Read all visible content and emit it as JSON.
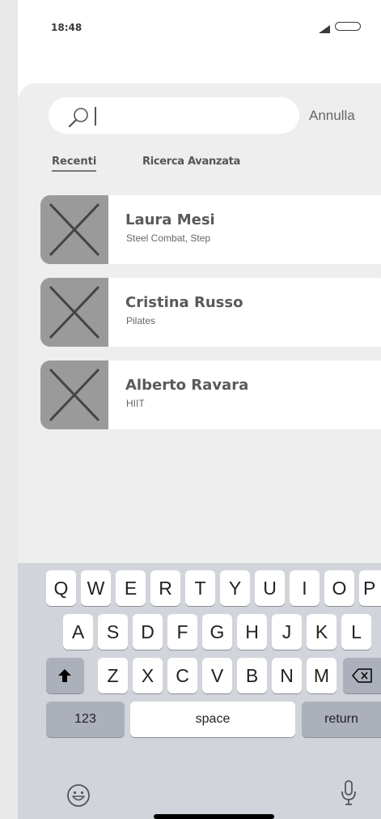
{
  "status_bar": {
    "time": "18:48",
    "icons": [
      "signal-icon",
      "battery-icon"
    ]
  },
  "search": {
    "value": "",
    "cancel_label": "Annulla"
  },
  "tabs": [
    {
      "label": "Recenti",
      "active": true
    },
    {
      "label": "Ricerca Avanzata",
      "active": false
    }
  ],
  "results": [
    {
      "name": "Laura Mesi",
      "subtitle": "Steel Combat, Step"
    },
    {
      "name": "Cristina Russo",
      "subtitle": "Pilates"
    },
    {
      "name": "Alberto Ravara",
      "subtitle": "HIIT"
    }
  ],
  "keyboard": {
    "row1": [
      "Q",
      "W",
      "E",
      "R",
      "T",
      "Y",
      "U",
      "I",
      "O",
      "P"
    ],
    "row2": [
      "A",
      "S",
      "D",
      "F",
      "G",
      "H",
      "J",
      "K",
      "L"
    ],
    "row3": [
      "Z",
      "X",
      "C",
      "V",
      "B",
      "N",
      "M"
    ],
    "numbers_label": "123",
    "space_label": "space",
    "return_label": "return"
  },
  "colors": {
    "sheet_bg": "#eeeeee",
    "keyboard_bg": "#d1d4db",
    "placeholder_gray": "#9a9a9a"
  }
}
